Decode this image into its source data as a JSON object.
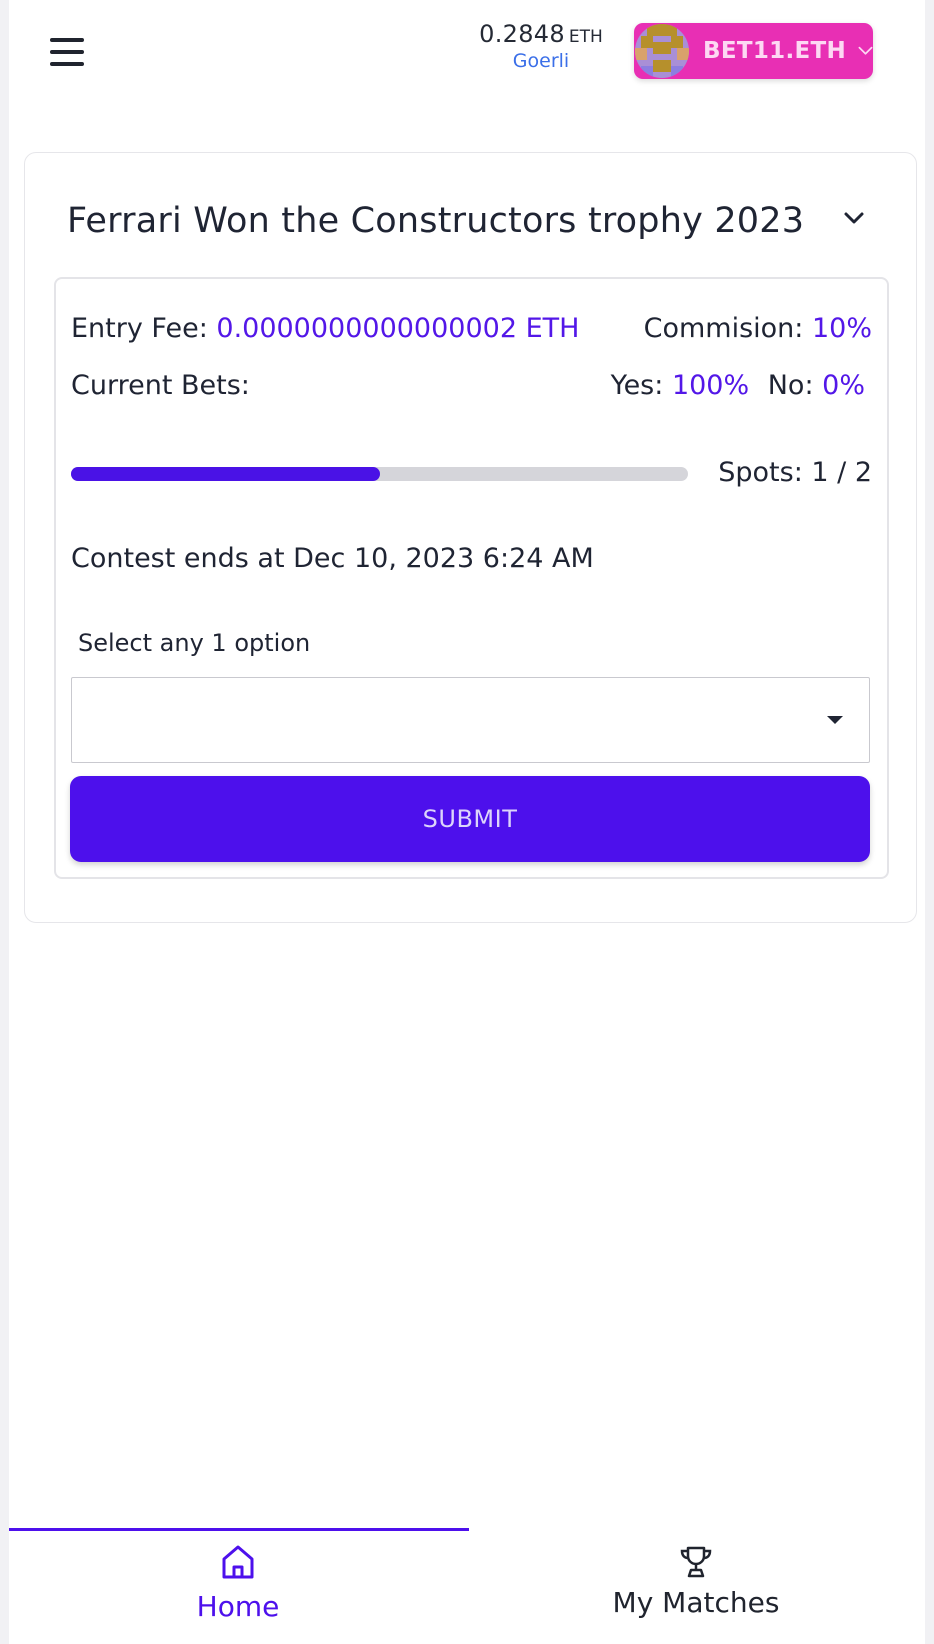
{
  "header": {
    "balance_amount": "0.2848",
    "balance_unit": "ETH",
    "network": "Goerli",
    "account_label": "BET11.ETH",
    "account_color": "#e82fb4",
    "menu_icon": "hamburger-menu-icon"
  },
  "contest": {
    "title": "Ferrari Won the Constructors trophy 2023",
    "entry_fee_label": "Entry Fee:",
    "entry_fee_value": "0.0000000000000002 ETH",
    "commission_label": "Commision:",
    "commission_value": "10%",
    "current_bets_label": "Current Bets:",
    "yes_label": "Yes:",
    "yes_value": "100%",
    "no_label": "No:",
    "no_value": "0%",
    "spots_text": "Spots: 1 / 2",
    "spots_filled_fraction": 0.5,
    "ends_text": "Contest ends at Dec 10, 2023 6:24 AM",
    "select_label": "Select any 1 option",
    "select_value": "",
    "submit_label": "SUBMIT",
    "accent_color": "#5317e8"
  },
  "bottom_nav": {
    "items": [
      {
        "label": "Home",
        "icon": "home-icon",
        "active": true
      },
      {
        "label": "My Matches",
        "icon": "trophy-icon",
        "active": false
      }
    ]
  }
}
